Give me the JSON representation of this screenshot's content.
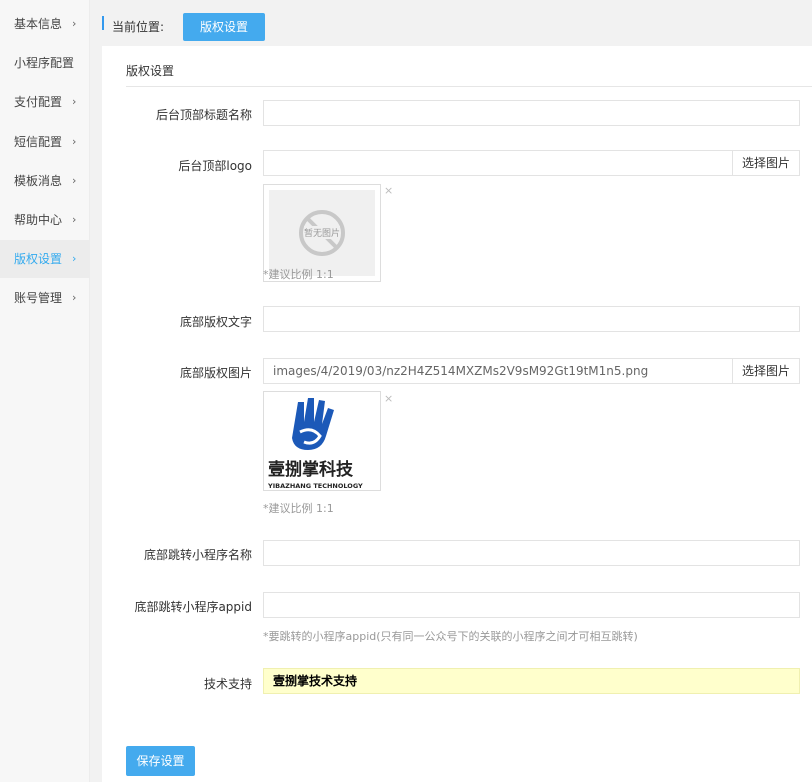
{
  "sidebar": {
    "items": [
      {
        "label": "基本信息",
        "has_chevron": true,
        "active": false
      },
      {
        "label": "小程序配置",
        "has_chevron": false,
        "active": false
      },
      {
        "label": "支付配置",
        "has_chevron": true,
        "active": false
      },
      {
        "label": "短信配置",
        "has_chevron": true,
        "active": false
      },
      {
        "label": "模板消息",
        "has_chevron": true,
        "active": false
      },
      {
        "label": "帮助中心",
        "has_chevron": true,
        "active": false
      },
      {
        "label": "版权设置",
        "has_chevron": true,
        "active": true
      },
      {
        "label": "账号管理",
        "has_chevron": true,
        "active": false
      }
    ],
    "chevron": "›",
    "active_color": "#33aaee"
  },
  "breadcrumb": {
    "label": "当前位置:",
    "current": "版权设置"
  },
  "panel": {
    "title": "版权设置"
  },
  "form": {
    "backend_title": {
      "label": "后台顶部标题名称",
      "value": ""
    },
    "backend_logo": {
      "label": "后台顶部logo",
      "value": "",
      "pick_label": "选择图片",
      "placeholder_image_text": "暂无图片",
      "hint": "*建议比例 1:1"
    },
    "footer_text": {
      "label": "底部版权文字",
      "value": ""
    },
    "footer_image": {
      "label": "底部版权图片",
      "value": "images/4/2019/03/nz2H4Z514MXZMs2V9sM92Gt19tM1n5.png",
      "pick_label": "选择图片",
      "logo_cn": "壹捌掌科技",
      "logo_en": "YIBAZHANG TECHNOLOGY",
      "hint": "*建议比例 1:1"
    },
    "footer_mini_name": {
      "label": "底部跳转小程序名称",
      "value": ""
    },
    "footer_mini_appid": {
      "label": "底部跳转小程序appid",
      "value": "",
      "hint": "*要跳转的小程序appid(只有同一公众号下的关联的小程序之间才可相互跳转)"
    },
    "tech_support": {
      "label": "技术支持",
      "value": "壹捌掌技术支持"
    }
  },
  "remove_glyph": "×",
  "save_label": "保存设置",
  "colors": {
    "primary": "#44aaee",
    "support_bg": "#ffffcc"
  }
}
